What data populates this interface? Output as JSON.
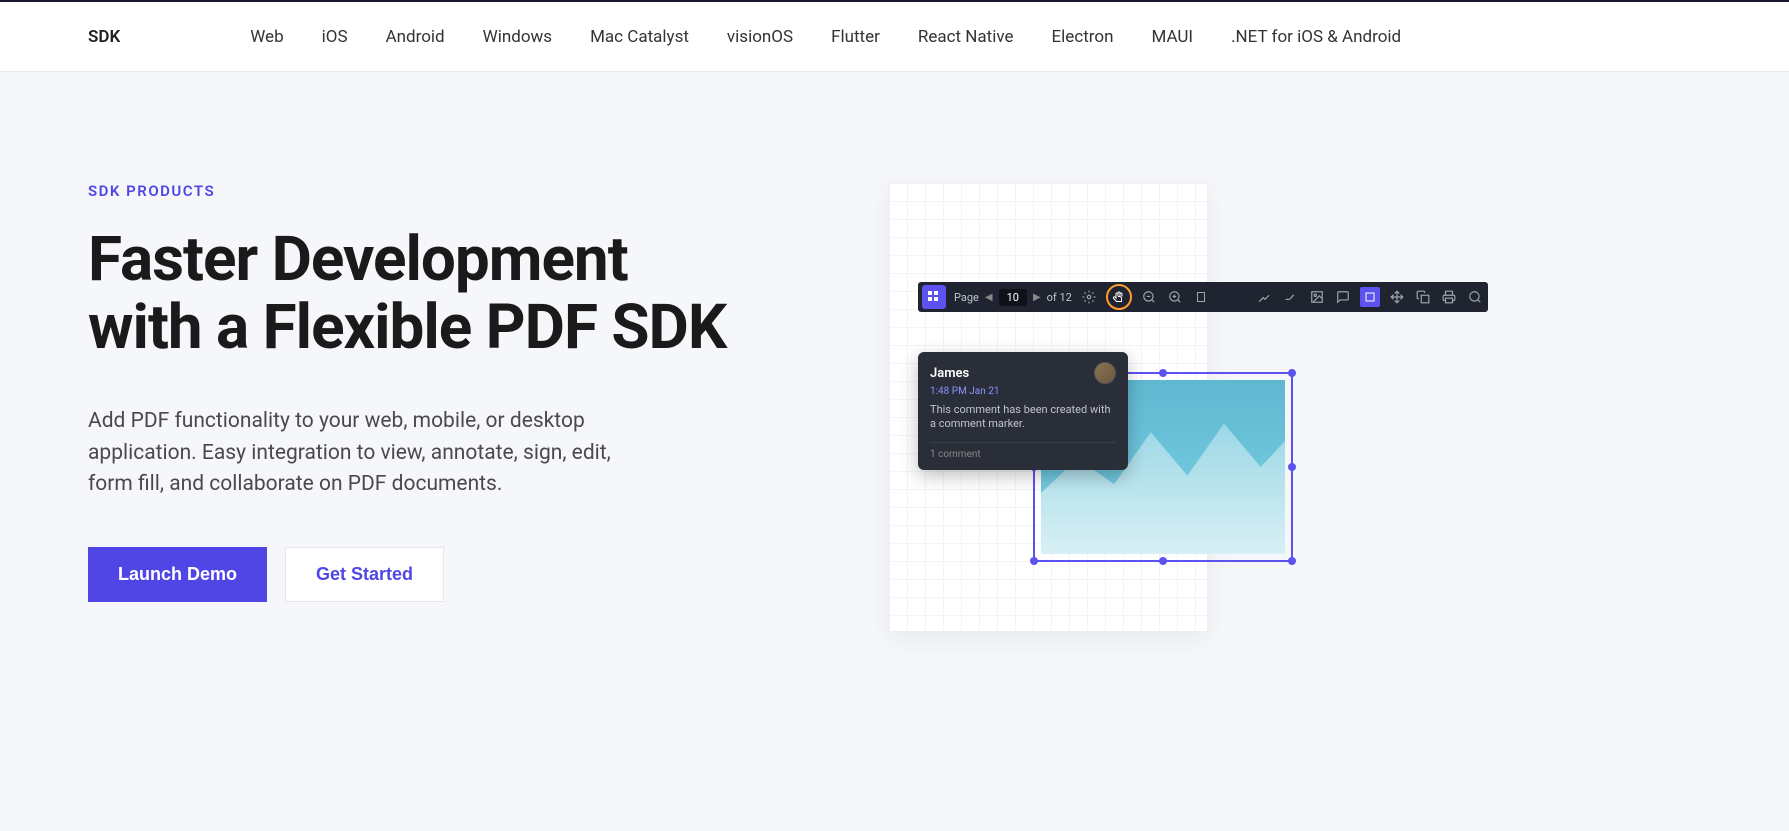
{
  "nav": {
    "brand": "SDK",
    "links": [
      "Web",
      "iOS",
      "Android",
      "Windows",
      "Mac Catalyst",
      "visionOS",
      "Flutter",
      "React Native",
      "Electron",
      "MAUI",
      ".NET for iOS & Android"
    ]
  },
  "hero": {
    "eyebrow": "SDK PRODUCTS",
    "title": "Faster Development with a Flexible PDF SDK",
    "subtitle": "Add PDF functionality to your web, mobile, or desktop application. Easy integration to view, annotate, sign, edit, form fill, and collaborate on PDF documents.",
    "cta_primary": "Launch Demo",
    "cta_secondary": "Get Started"
  },
  "toolbar": {
    "page_label": "Page",
    "current_page": "10",
    "total_label": "of 12"
  },
  "comment": {
    "author": "James",
    "timestamp": "1:48 PM Jan 21",
    "body": "This comment has been created with a comment marker.",
    "footer": "1 comment"
  }
}
